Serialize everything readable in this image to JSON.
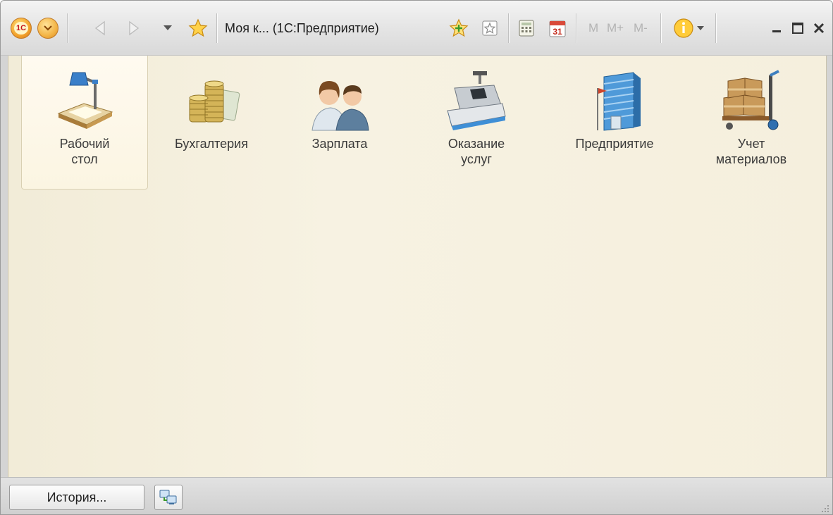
{
  "titlebar": {
    "title": "Моя к... (1С:Предприятие)",
    "logo_icon": "1c-logo-icon",
    "main_menu_icon": "main-menu-icon",
    "m_label": "M",
    "m_plus_label": "M+",
    "m_minus_label": "M-"
  },
  "sections": [
    {
      "label": "Рабочий\nстол",
      "icon": "desk-lamp-icon"
    },
    {
      "label": "Бухгалтерия",
      "icon": "coins-icon"
    },
    {
      "label": "Зарплата",
      "icon": "employees-icon"
    },
    {
      "label": "Оказание\nуслуг",
      "icon": "cash-register-icon"
    },
    {
      "label": "Предприятие",
      "icon": "building-icon"
    },
    {
      "label": "Учет\nматериалов",
      "icon": "pallet-jack-boxes-icon"
    }
  ],
  "bottombar": {
    "history_label": "История..."
  },
  "colors": {
    "panel_background": "#f5efdd",
    "accent_orange": "#f2a12a",
    "active_section_background": "#fffaf0"
  }
}
